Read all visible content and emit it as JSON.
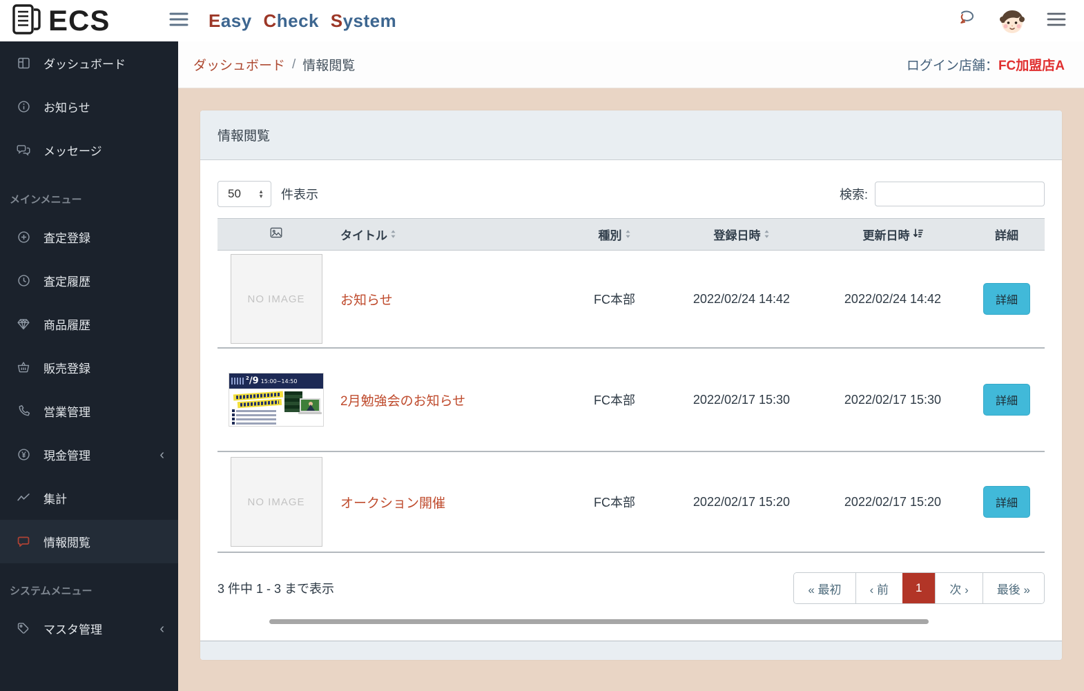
{
  "header": {
    "logo": "ECS",
    "title_words": [
      "Easy",
      "Check",
      "System"
    ],
    "login_label": "ログイン店舗：",
    "login_store": "FC加盟店A"
  },
  "breadcrumb": {
    "parent": "ダッシュボード",
    "separator": "/",
    "current": "情報閲覧"
  },
  "sidebar": {
    "items": [
      {
        "label": "ダッシュボード",
        "icon": "dashboard"
      },
      {
        "label": "お知らせ",
        "icon": "info-circle"
      },
      {
        "label": "メッセージ",
        "icon": "comments"
      },
      {
        "label": "メインメニュー",
        "type": "section"
      },
      {
        "label": "査定登録",
        "icon": "plus-circle"
      },
      {
        "label": "査定履歴",
        "icon": "clock"
      },
      {
        "label": "商品履歴",
        "icon": "gem"
      },
      {
        "label": "販売登録",
        "icon": "basket"
      },
      {
        "label": "営業管理",
        "icon": "phone"
      },
      {
        "label": "現金管理",
        "icon": "yen",
        "chevron": "‹"
      },
      {
        "label": "集計",
        "icon": "chart-line"
      },
      {
        "label": "情報閲覧",
        "icon": "comment",
        "active": true
      },
      {
        "label": "システムメニュー",
        "type": "section"
      },
      {
        "label": "マスタ管理",
        "icon": "tags",
        "chevron": "‹"
      }
    ]
  },
  "panel": {
    "title": "情報閲覧",
    "page_length": {
      "value": "50",
      "suffix": "件表示"
    },
    "search_label": "検索:"
  },
  "table": {
    "headers": [
      "image",
      "タイトル",
      "種別",
      "登録日時",
      "更新日時",
      "詳細"
    ],
    "rows": [
      {
        "image_text": "NO IMAGE",
        "title": "お知らせ",
        "type": "FC本部",
        "registered": "2022/02/24 14:42",
        "updated": "2022/02/24 14:42",
        "detail_label": "詳細"
      },
      {
        "banner": {
          "day_sup": "2",
          "day": "9",
          "time": "15:00~14:50"
        },
        "title": "2月勉強会のお知らせ",
        "type": "FC本部",
        "registered": "2022/02/17 15:30",
        "updated": "2022/02/17 15:30",
        "detail_label": "詳細"
      },
      {
        "image_text": "NO IMAGE",
        "title": "オークション開催",
        "type": "FC本部",
        "registered": "2022/02/17 15:20",
        "updated": "2022/02/17 15:20",
        "detail_label": "詳細"
      }
    ]
  },
  "footer": {
    "info": "3 件中 1 - 3 まで表示",
    "pagination": {
      "first": "« 最初",
      "prev": "‹ 前",
      "page": "1",
      "next": "次 ›",
      "last": "最後 »"
    }
  },
  "colors": {
    "accent_red": "#b23527",
    "link_red": "#bf4b2d",
    "detail_button": "#41b9d9",
    "sidebar_bg": "#1b222c",
    "content_bg": "#e9d5c5",
    "card_header_bg": "#e9eef2"
  }
}
